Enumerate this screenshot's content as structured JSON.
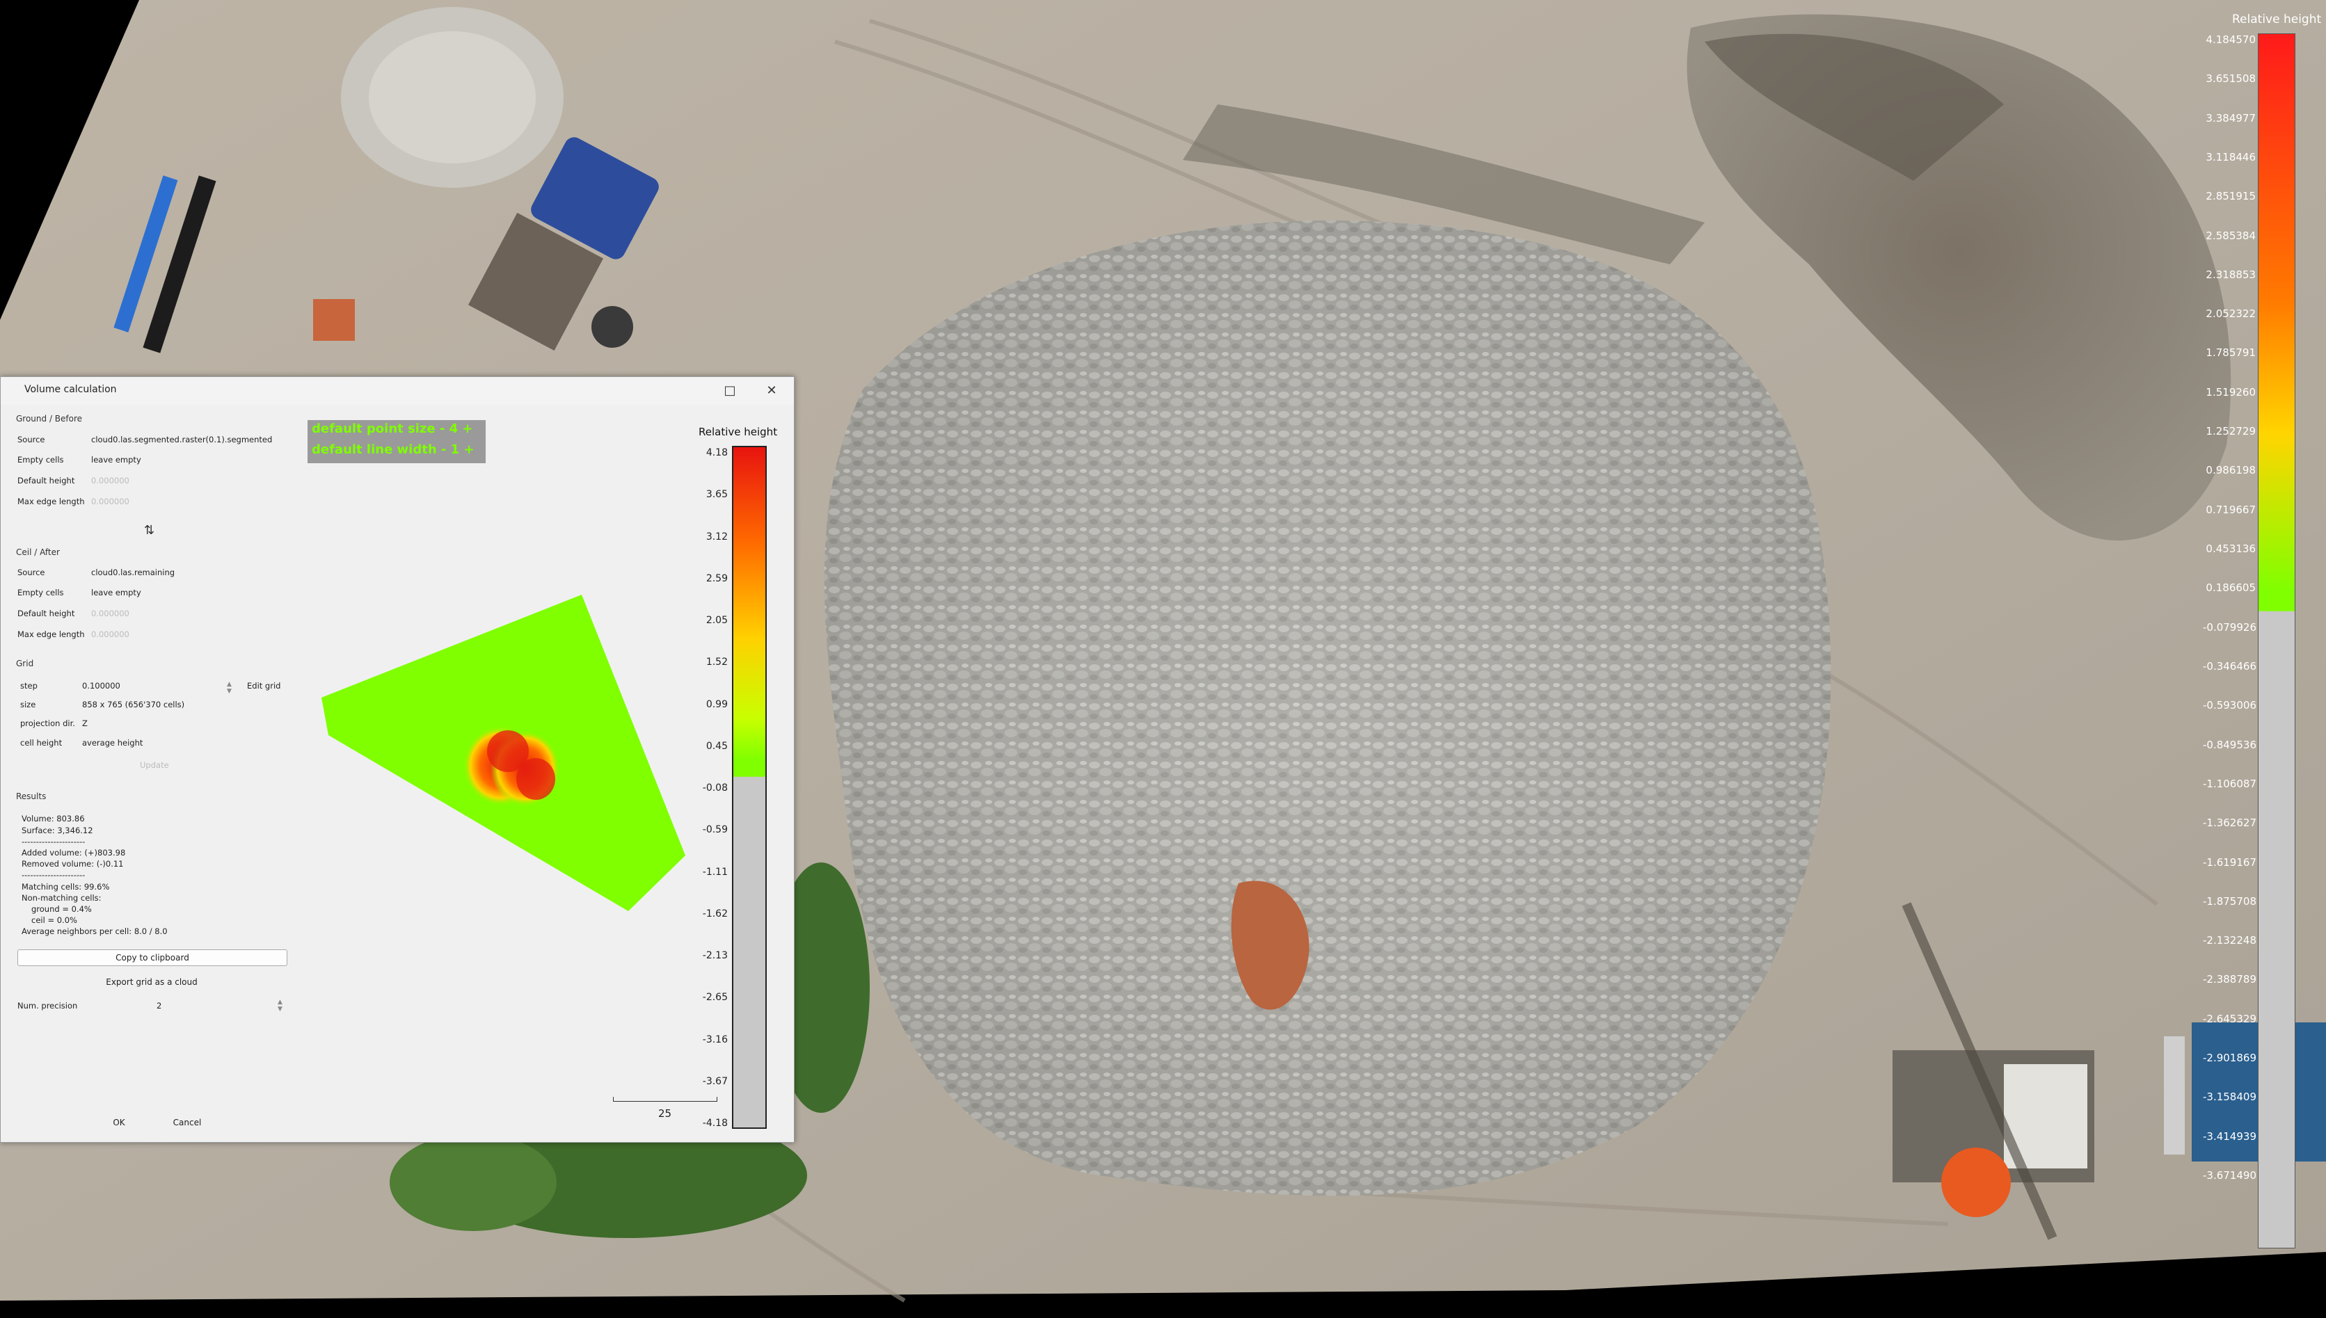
{
  "right_scale": {
    "title": "Relative height",
    "ticks": [
      "4.184570",
      "3.651508",
      "3.384977",
      "3.118446",
      "2.851915",
      "2.585384",
      "2.318853",
      "2.052322",
      "1.785791",
      "1.519260",
      "1.252729",
      "0.986198",
      "0.719667",
      "0.453136",
      "0.186605",
      "-0.079926",
      "-0.346466",
      "-0.593006",
      "-0.849536",
      "-1.106087",
      "-1.362627",
      "-1.619167",
      "-1.875708",
      "-2.132248",
      "-2.388789",
      "-2.645329",
      "-2.901869",
      "-3.158409",
      "-3.414939",
      "-3.671490"
    ],
    "colors": {
      "top": "#ff1a1a",
      "mid": "#ffd500",
      "low": "#7fff00",
      "gray": "#c8c8c8"
    }
  },
  "dialog": {
    "title": "Volume calculation",
    "maximize_icon": "maximize-icon",
    "close_icon": "close-icon",
    "ground": {
      "section": "Ground / Before",
      "source_label": "Source",
      "source_value": "cloud0.las.segmented.raster(0.1).segmented",
      "empty_label": "Empty cells",
      "empty_value": "leave empty",
      "height_label": "Default height",
      "height_value": "0.000000",
      "edge_label": "Max edge length",
      "edge_value": "0.000000"
    },
    "swap_icon": "swap-icon",
    "ceil": {
      "section": "Ceil / After",
      "source_label": "Source",
      "source_value": "cloud0.las.remaining",
      "empty_label": "Empty cells",
      "empty_value": "leave empty",
      "height_label": "Default height",
      "height_value": "0.000000",
      "edge_label": "Max edge length",
      "edge_value": "0.000000"
    },
    "grid": {
      "section": "Grid",
      "step_label": "step",
      "step_value": "0.100000",
      "edit_grid": "Edit grid",
      "size_label": "size",
      "size_value": "858 x 765 (656'370 cells)",
      "projection_label": "projection dir.",
      "projection_value": "Z",
      "cell_label": "cell height",
      "cell_value": "average height",
      "update": "Update"
    },
    "results": {
      "section": "Results",
      "volume": "Volume: 803.86",
      "surface": "Surface: 3,346.12",
      "sep1": "----------------------",
      "added": "Added volume: (+)803.98",
      "removed": "Removed volume: (-)0.11",
      "sep2": "----------------------",
      "matching": "Matching cells: 99.6%",
      "nonmatching": "Non-matching cells:",
      "ground_pct": "ground = 0.4%",
      "cell_pct": "ceil = 0.0%",
      "neighbors": "Average neighbors per cell: 8.0 / 8.0"
    },
    "copy_button": "Copy to clipboard",
    "export_button": "Export grid as a cloud",
    "precision_label": "Num. precision",
    "precision_value": "2",
    "ok_button": "OK",
    "cancel_button": "Cancel",
    "preview": {
      "info_line1": "default point size   - 4 +",
      "info_line2": "default line width   - 1 +",
      "scale_title": "Relative height",
      "scale_ticks": [
        "4.18",
        "3.65",
        "3.12",
        "2.59",
        "2.05",
        "1.52",
        "0.99",
        "0.45",
        "-0.08",
        "-0.59",
        "-1.11",
        "-1.62",
        "-2.13",
        "-2.65",
        "-3.16",
        "-3.67",
        "-4.18"
      ],
      "scale_bar_value": "25"
    }
  }
}
